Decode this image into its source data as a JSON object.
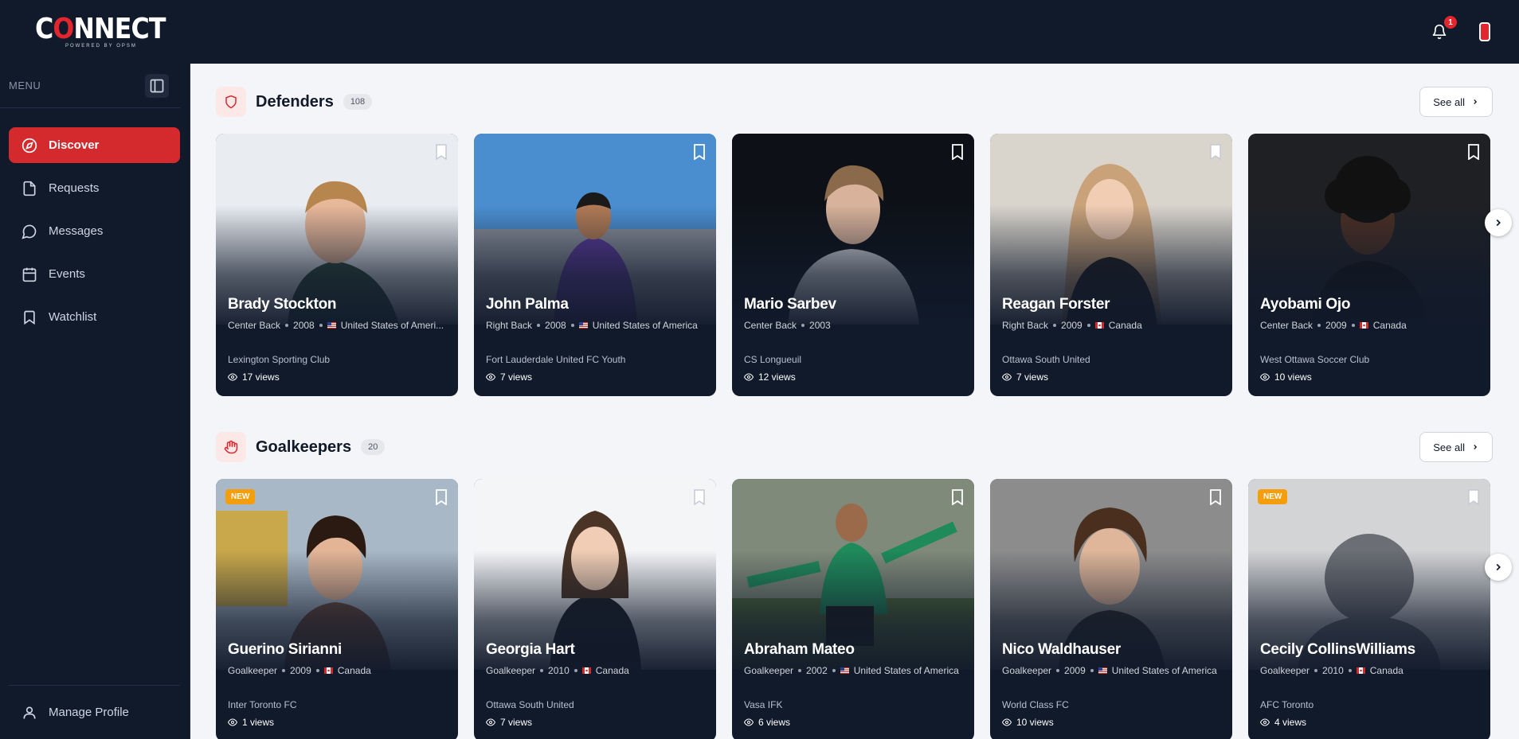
{
  "app": {
    "logo_text": "CONNECT",
    "logo_tagline": "POWERED BY OPSM",
    "notification_count": "1"
  },
  "sidebar": {
    "menu_label": "MENU",
    "items": [
      {
        "label": "Discover",
        "icon": "compass-icon",
        "active": true
      },
      {
        "label": "Requests",
        "icon": "document-icon"
      },
      {
        "label": "Messages",
        "icon": "chat-bubble-icon"
      },
      {
        "label": "Events",
        "icon": "calendar-icon"
      },
      {
        "label": "Watchlist",
        "icon": "bookmark-icon"
      }
    ],
    "manage_profile": "Manage Profile"
  },
  "sections": [
    {
      "title": "Defenders",
      "count": "108",
      "see_all": "See all",
      "icon": "shield-icon",
      "players": [
        {
          "name": "Brady Stockton",
          "position": "Center Back",
          "year": "2008",
          "country": "United States of Ameri...",
          "flag": "us",
          "club": "Lexington Sporting Club",
          "views": "17 views"
        },
        {
          "name": "John Palma",
          "position": "Right Back",
          "year": "2008",
          "country": "United States of America",
          "flag": "us",
          "club": "Fort Lauderdale United FC Youth",
          "views": "7 views"
        },
        {
          "name": "Mario Sarbev",
          "position": "Center Back",
          "year": "2003",
          "country": "",
          "flag": "",
          "club": "CS Longueuil",
          "views": "12 views"
        },
        {
          "name": "Reagan Forster",
          "position": "Right Back",
          "year": "2009",
          "country": "Canada",
          "flag": "ca",
          "club": "Ottawa South United",
          "views": "7 views"
        },
        {
          "name": "Ayobami Ojo",
          "position": "Center Back",
          "year": "2009",
          "country": "Canada",
          "flag": "ca",
          "club": "West Ottawa Soccer Club",
          "views": "10 views"
        }
      ]
    },
    {
      "title": "Goalkeepers",
      "count": "20",
      "see_all": "See all",
      "icon": "hand-icon",
      "players": [
        {
          "name": "Guerino Sirianni",
          "position": "Goalkeeper",
          "year": "2009",
          "country": "Canada",
          "flag": "ca",
          "club": "Inter Toronto FC",
          "views": "1 views",
          "badge": "NEW"
        },
        {
          "name": "Georgia Hart",
          "position": "Goalkeeper",
          "year": "2010",
          "country": "Canada",
          "flag": "ca",
          "club": "Ottawa South United",
          "views": "7 views"
        },
        {
          "name": "Abraham Mateo",
          "position": "Goalkeeper",
          "year": "2002",
          "country": "United States of America",
          "flag": "us",
          "club": "Vasa IFK",
          "views": "6 views"
        },
        {
          "name": "Nico Waldhauser",
          "position": "Goalkeeper",
          "year": "2009",
          "country": "United States of America",
          "flag": "us",
          "club": "World Class FC",
          "views": "10 views"
        },
        {
          "name": "Cecily CollinsWilliams",
          "position": "Goalkeeper",
          "year": "2010",
          "country": "Canada",
          "flag": "ca",
          "club": "AFC Toronto",
          "views": "4 views",
          "badge": "NEW"
        }
      ]
    }
  ],
  "colors": {
    "brand_red": "#d42a2e",
    "navy": "#111a2b",
    "badge_orange": "#f59e0b"
  }
}
